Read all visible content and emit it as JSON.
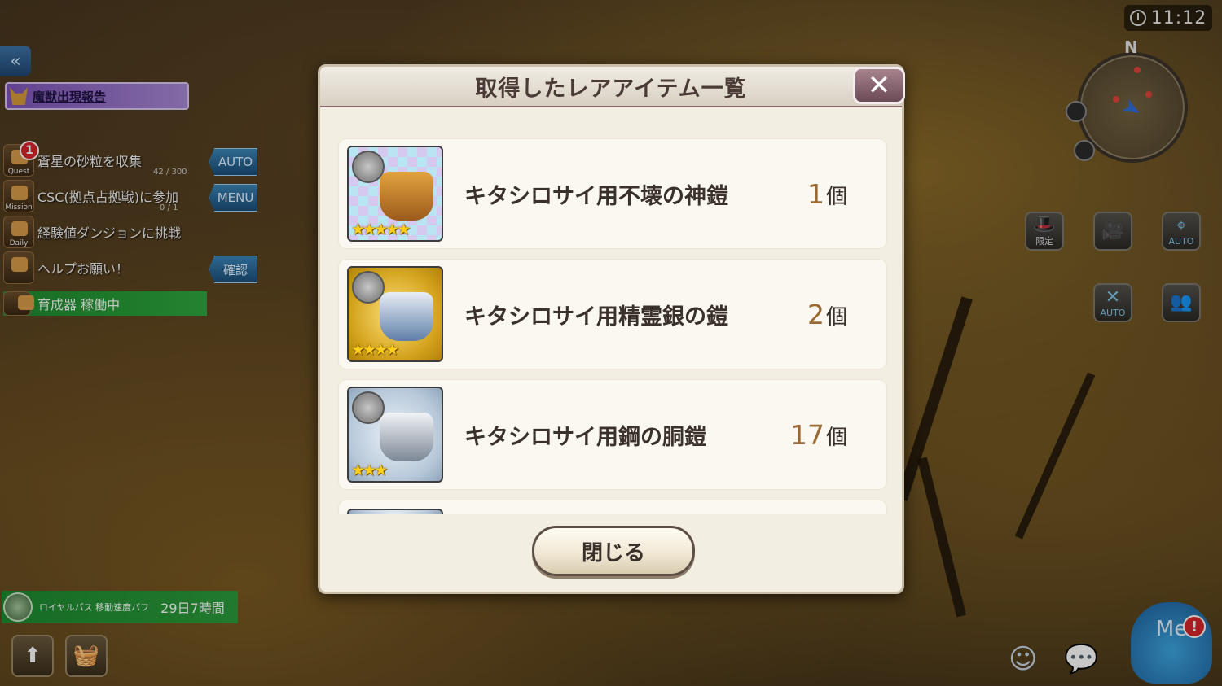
{
  "hud": {
    "clock": "11:12",
    "compass_n": "N",
    "alert_label": "魔獣出現報告",
    "quests": [
      {
        "tag": "Quest",
        "text": "蒼星の砂粒を収集",
        "progress": "42 / 300",
        "side": "AUTO"
      },
      {
        "tag": "Mission",
        "text": "CSC(拠点占拠戦)に参加",
        "progress": "0 / 1",
        "side": "MENU"
      },
      {
        "tag": "Daily",
        "text": "経験値ダンジョンに挑戦",
        "progress": "",
        "side": ""
      },
      {
        "tag": "",
        "text": "ヘルプお願い！",
        "progress": "",
        "side": "確認"
      }
    ],
    "quest_badge": "1",
    "hatcher": "育成器 稼働中",
    "royal_pass": {
      "name": "ロイヤルパス 移動速度バフ",
      "time": "29日7時間"
    },
    "right_buttons": [
      {
        "label": "限定",
        "icon": "hat-icon"
      },
      {
        "label": "",
        "icon": "camera-icon"
      },
      {
        "label": "AUTO",
        "icon": "auto-target-icon"
      },
      {
        "label": "AUTO",
        "icon": "auto-skill-icon"
      },
      {
        "label": "",
        "icon": "party-icon"
      }
    ],
    "me_label": "Me",
    "me_alert": "!"
  },
  "modal": {
    "title": "取得したレアアイテム一覧",
    "close_x": "✕",
    "items": [
      {
        "name": "キタシロサイ用不壊の神鎧",
        "count": "1",
        "unit": "個",
        "stars": "★★★★★",
        "rarity": 5
      },
      {
        "name": "キタシロサイ用精霊銀の鎧",
        "count": "2",
        "unit": "個",
        "stars": "★★★★",
        "rarity": 4
      },
      {
        "name": "キタシロサイ用鋼の胴鎧",
        "count": "17",
        "unit": "個",
        "stars": "★★★",
        "rarity": 3
      }
    ],
    "close_button": "閉じる"
  }
}
